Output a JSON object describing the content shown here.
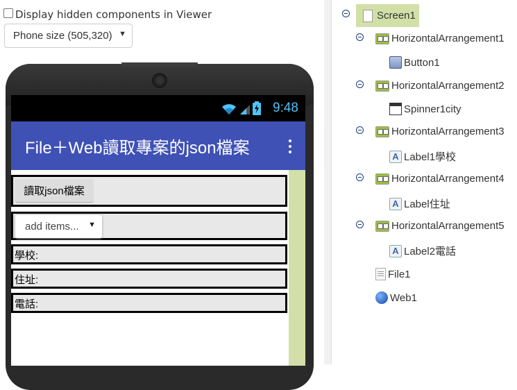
{
  "viewer": {
    "hidden_components_label": "Display hidden components in Viewer",
    "phone_size": "Phone size (505,320)"
  },
  "phone": {
    "time": "9:48",
    "app_title": "File＋Web讀取專案的json檔案",
    "button1_label": "讀取json檔案",
    "spinner_label": "add items...",
    "label_school": "學校:",
    "label_address": "住址:",
    "label_phone": "電話:"
  },
  "components": {
    "screen1": "Screen1",
    "harr1": "HorizontalArrangement1",
    "button1": "Button1",
    "harr2": "HorizontalArrangement2",
    "spinner": "Spinner1city",
    "harr3": "HorizontalArrangement3",
    "label1": "Label1學校",
    "harr4": "HorizontalArrangement4",
    "label_addr": "Label住址",
    "harr5": "HorizontalArrangement5",
    "label2": "Label2電話",
    "file1": "File1",
    "web1": "Web1"
  },
  "icons": {
    "wifi": "wifi-icon",
    "signal": "signal-icon",
    "battery": "battery-charging-icon",
    "overflow": "overflow-menu-icon"
  },
  "colors": {
    "appbar": "#3f51b5",
    "selected_component": "#d2e0a8",
    "status_time": "#4fc3f7"
  }
}
